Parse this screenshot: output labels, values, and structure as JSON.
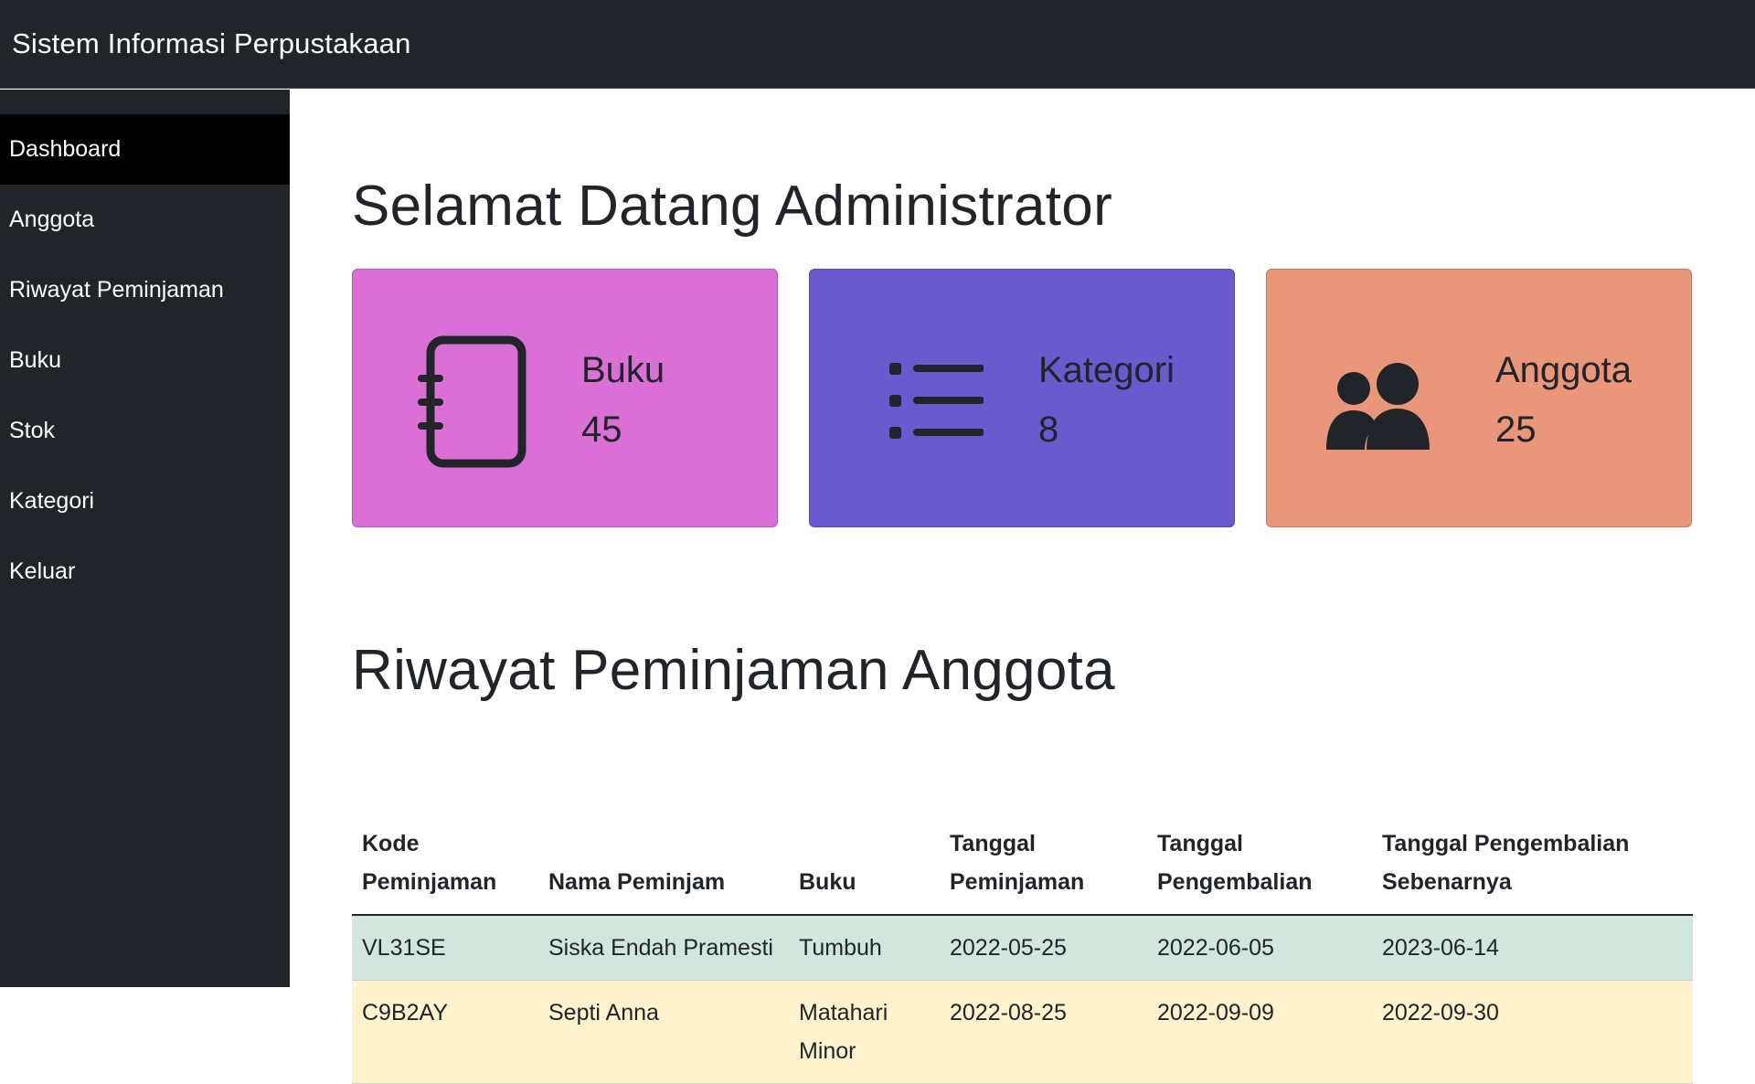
{
  "app": {
    "brand": "Sistem Informasi Perpustakaan"
  },
  "sidebar": {
    "items": [
      {
        "label": "Dashboard",
        "active": true
      },
      {
        "label": "Anggota"
      },
      {
        "label": "Riwayat Peminjaman"
      },
      {
        "label": "Buku"
      },
      {
        "label": "Stok"
      },
      {
        "label": "Kategori"
      },
      {
        "label": "Keluar"
      }
    ]
  },
  "main": {
    "welcome": "Selamat Datang Administrator",
    "cards": [
      {
        "label": "Buku",
        "value": "45",
        "icon": "journal-icon",
        "color": "#da70d6"
      },
      {
        "label": "Kategori",
        "value": "8",
        "icon": "list-icon",
        "color": "#6a5acd"
      },
      {
        "label": "Anggota",
        "value": "25",
        "icon": "people-icon",
        "color": "#e9967a"
      }
    ],
    "history_title": "Riwayat Peminjaman Anggota",
    "table": {
      "headers": [
        "Kode Peminjaman",
        "Nama Peminjam",
        "Buku",
        "Tanggal Peminjaman",
        "Tanggal Pengembalian",
        "Tanggal Pengembalian Sebenarnya"
      ],
      "rows": [
        {
          "status": "success",
          "cells": [
            "VL31SE",
            "Siska Endah Pramesti",
            "Tumbuh",
            "2022-05-25",
            "2022-06-05",
            "2023-06-14"
          ]
        },
        {
          "status": "warning",
          "cells": [
            "C9B2AY",
            "Septi Anna",
            "Matahari Minor",
            "2022-08-25",
            "2022-09-09",
            "2022-09-30"
          ]
        }
      ]
    }
  }
}
